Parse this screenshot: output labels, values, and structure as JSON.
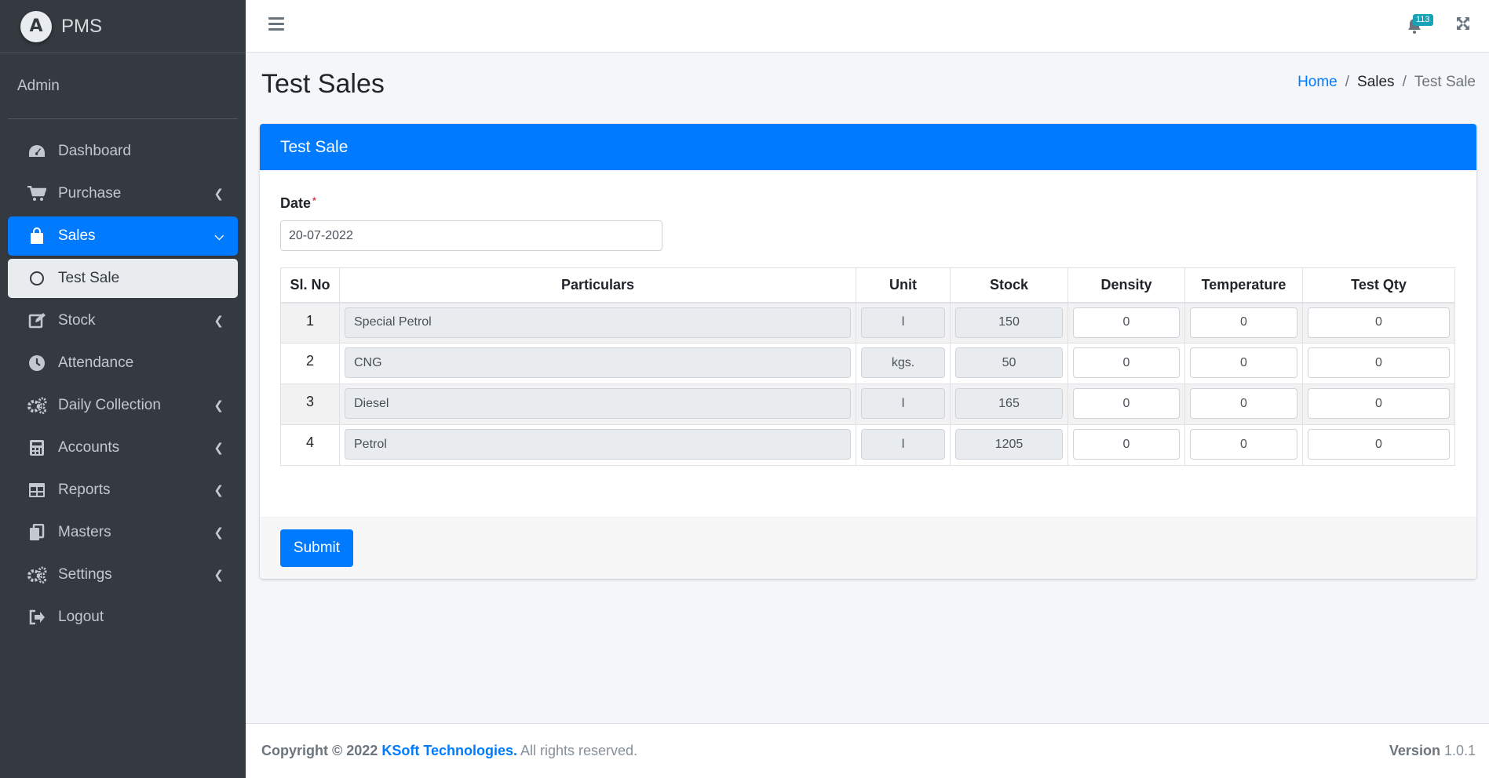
{
  "brand": {
    "name": "PMS",
    "logo_letter": "A"
  },
  "user": {
    "name": "Admin"
  },
  "sidebar": {
    "items": [
      {
        "label": "Dashboard",
        "icon": "dashboard-icon",
        "has_arrow": false
      },
      {
        "label": "Purchase",
        "icon": "cart-icon",
        "has_arrow": true
      },
      {
        "label": "Sales",
        "icon": "shopping-bag-icon",
        "has_arrow": true,
        "state": "active"
      },
      {
        "label": "Test Sale",
        "icon": "circle-icon",
        "has_arrow": false,
        "state": "sub-active"
      },
      {
        "label": "Stock",
        "icon": "edit-icon",
        "has_arrow": true
      },
      {
        "label": "Attendance",
        "icon": "clock-icon",
        "has_arrow": false
      },
      {
        "label": "Daily Collection",
        "icon": "gears-icon",
        "has_arrow": true
      },
      {
        "label": "Accounts",
        "icon": "calculator-icon",
        "has_arrow": true
      },
      {
        "label": "Reports",
        "icon": "table-icon",
        "has_arrow": true
      },
      {
        "label": "Masters",
        "icon": "copy-icon",
        "has_arrow": true
      },
      {
        "label": "Settings",
        "icon": "gears-icon",
        "has_arrow": true
      },
      {
        "label": "Logout",
        "icon": "sign-out-icon",
        "has_arrow": false
      }
    ]
  },
  "topbar": {
    "notification_count": "113"
  },
  "page": {
    "title": "Test Sales"
  },
  "breadcrumb": {
    "home": "Home",
    "section": "Sales",
    "current": "Test Sale",
    "separator": "/"
  },
  "card": {
    "title": "Test Sale",
    "date_label": "Date",
    "date_required_mark": "*",
    "date_value": "20-07-2022",
    "columns": [
      "Sl. No",
      "Particulars",
      "Unit",
      "Stock",
      "Density",
      "Temperature",
      "Test Qty"
    ],
    "rows": [
      {
        "sl": "1",
        "particular": "Special Petrol",
        "unit": "l",
        "stock": "150",
        "density": "0",
        "temperature": "0",
        "test_qty": "0"
      },
      {
        "sl": "2",
        "particular": "CNG",
        "unit": "kgs.",
        "stock": "50",
        "density": "0",
        "temperature": "0",
        "test_qty": "0"
      },
      {
        "sl": "3",
        "particular": "Diesel",
        "unit": "l",
        "stock": "165",
        "density": "0",
        "temperature": "0",
        "test_qty": "0"
      },
      {
        "sl": "4",
        "particular": "Petrol",
        "unit": "l",
        "stock": "1205",
        "density": "0",
        "temperature": "0",
        "test_qty": "0"
      }
    ],
    "submit_label": "Submit"
  },
  "footer": {
    "copyright": "Copyright © 2022",
    "company": "KSoft Technologies.",
    "rights": "All rights reserved.",
    "version_label": "Version",
    "version_value": "1.0.1"
  },
  "colors": {
    "primary": "#007bff",
    "sidebar_bg": "#343a40",
    "badge": "#17a2b8"
  }
}
